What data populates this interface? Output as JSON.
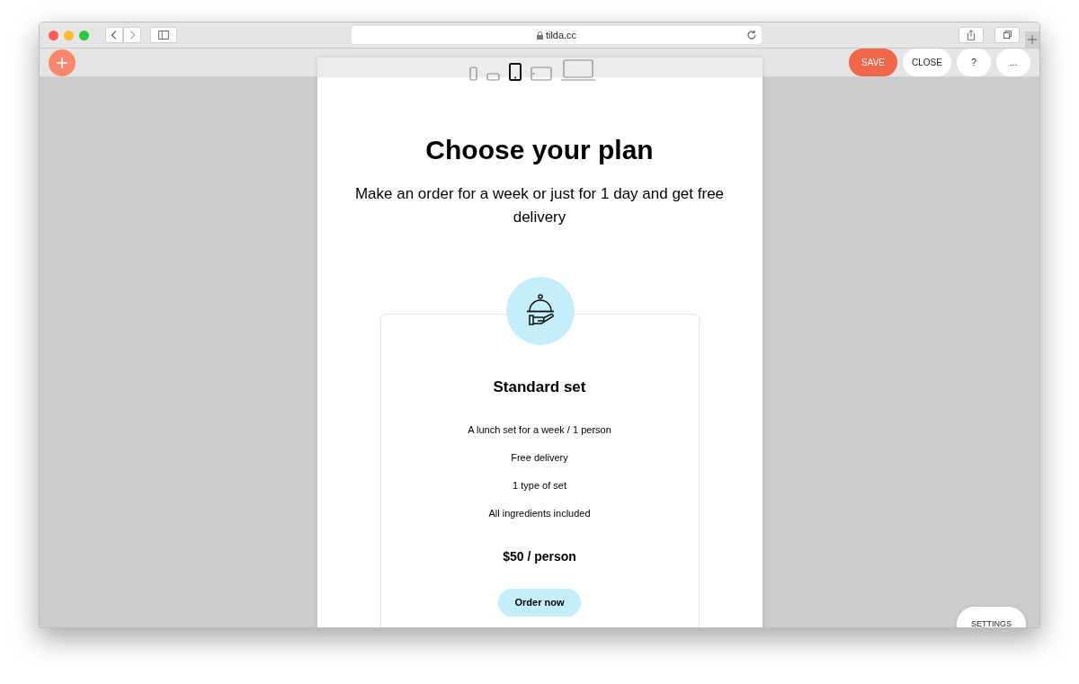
{
  "browser": {
    "address": "tilda.cc"
  },
  "toolbar": {
    "devices": [
      {
        "kind": "phone",
        "selected": false
      },
      {
        "kind": "phone-landscape",
        "selected": false
      },
      {
        "kind": "tablet",
        "selected": true
      },
      {
        "kind": "tablet-landscape",
        "selected": false
      },
      {
        "kind": "laptop",
        "selected": false
      }
    ],
    "buttons": [
      {
        "label": "SAVE",
        "kind": "primary"
      },
      {
        "label": "CLOSE",
        "kind": "plain"
      },
      {
        "label": "?",
        "kind": "plain"
      },
      {
        "label": "...",
        "kind": "plain"
      }
    ]
  },
  "page": {
    "title": "Choose your plan",
    "subtitle": "Make an order for a week or just for 1 day and get free delivery",
    "card": {
      "title": "Standard set",
      "features": [
        "A lunch set for a week / 1 person",
        "Free delivery",
        "1 type of set",
        "All ingredients included"
      ],
      "price": "$50 / person",
      "button": "Order now"
    }
  },
  "settings_button": "SETTINGS"
}
